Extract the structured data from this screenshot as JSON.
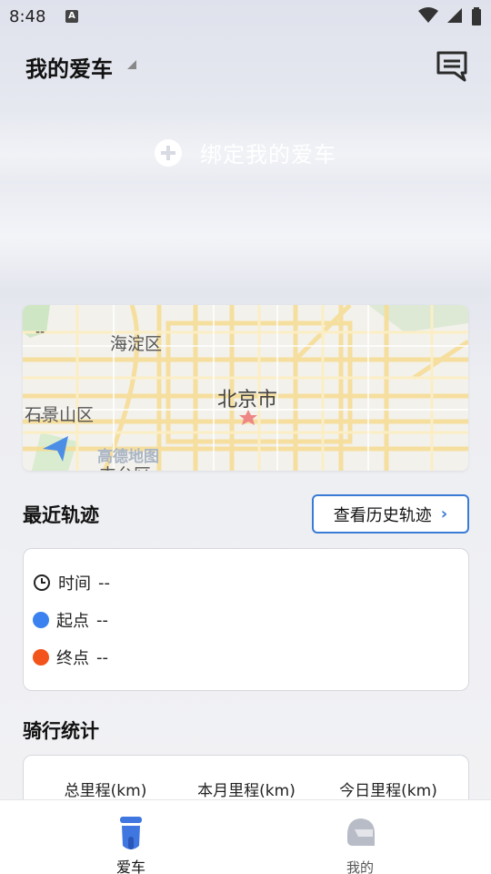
{
  "status_bar": {
    "time": "8:48",
    "notif_letter": "A"
  },
  "header": {
    "title": "我的爱车"
  },
  "bind_car": {
    "label": "绑定我的爱车"
  },
  "map": {
    "placeholders": [
      "--",
      "--"
    ],
    "labels": {
      "haidian": "海淀区",
      "beijing": "北京市",
      "shijingshan": "石景山区",
      "fengtai": "丰台区"
    },
    "logo": "高德地图"
  },
  "recent_track": {
    "title": "最近轨迹",
    "history_button": "查看历史轨迹",
    "rows": [
      {
        "label": "时间",
        "value": "--"
      },
      {
        "label": "起点",
        "value": "--"
      },
      {
        "label": "终点",
        "value": "--"
      }
    ]
  },
  "riding_stats": {
    "title": "骑行统计",
    "columns": [
      "总里程(km)",
      "本月里程(km)",
      "今日里程(km)"
    ]
  },
  "tabbar": {
    "tabs": [
      {
        "label": "爱车",
        "active": true
      },
      {
        "label": "我的",
        "active": false
      }
    ]
  },
  "colors": {
    "accent": "#3a7bd5",
    "start_dot": "#3b82f0",
    "end_dot": "#f2541b",
    "tab_active": "#3f76e0",
    "tab_inactive": "#b8bcc6"
  }
}
